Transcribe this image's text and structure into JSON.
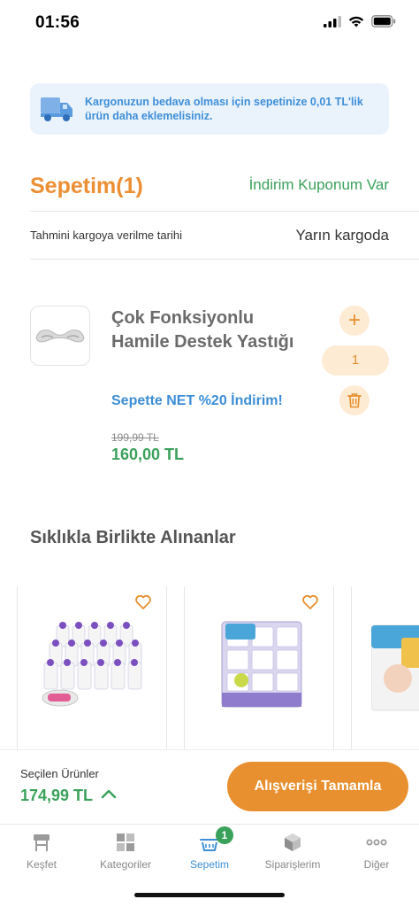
{
  "status_bar": {
    "time": "01:56"
  },
  "cargo_banner": {
    "text": "Kargonuzun bedava olması için sepetinize 0,01 TL'lik ürün daha eklemelisiniz."
  },
  "cart": {
    "title": "Sepetim(1)",
    "coupon_link": "İndirim Kuponum Var",
    "shipping_label": "Tahmini kargoya verilme tarihi",
    "shipping_value": "Yarın kargoda"
  },
  "cart_item": {
    "name": "Çok Fonksiyonlu Hamile Destek Yastığı",
    "quantity": "1",
    "plus_symbol": "+",
    "discount_note": "Sepette NET %20 İndirim!",
    "old_price": "199,99 TL",
    "new_price": "160,00 TL"
  },
  "related": {
    "title": "Sıklıkla Birlikte Alınanlar"
  },
  "checkout": {
    "selected_label": "Seçilen Ürünler",
    "total": "174,99 TL",
    "button_label": "Alışverişi Tamamla"
  },
  "tabs": [
    {
      "label": "Keşfet",
      "icon": "discover-icon"
    },
    {
      "label": "Kategoriler",
      "icon": "grid-icon"
    },
    {
      "label": "Sepetim",
      "icon": "basket-icon",
      "active": true,
      "badge": "1"
    },
    {
      "label": "Siparişlerim",
      "icon": "box-icon"
    },
    {
      "label": "Diğer",
      "icon": "more-icon"
    }
  ],
  "colors": {
    "accent_orange": "#e8902f",
    "price_green": "#3aa15b",
    "link_blue": "#3c8ed6",
    "banner_bg": "#eaf3fc"
  }
}
